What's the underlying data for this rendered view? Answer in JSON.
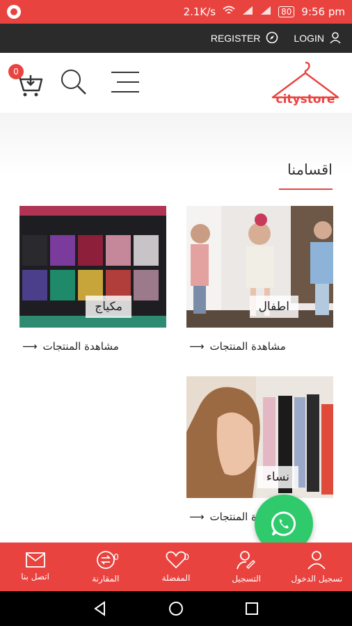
{
  "status": {
    "speed": "2.1K/s",
    "battery": "80",
    "time": "9:56 pm"
  },
  "topbar": {
    "register": "REGISTER",
    "login": "LOGIN"
  },
  "header": {
    "cart_count": "0",
    "logo_text": "citystore"
  },
  "section": {
    "title": "اقسامنا"
  },
  "categories": [
    {
      "name": "اطفال",
      "link": "مشاهدة المنتجات"
    },
    {
      "name": "مكياج",
      "link": "مشاهدة المنتجات"
    },
    {
      "name": "نساء",
      "link": "مشاهدة المنتجات"
    }
  ],
  "bottom_nav": [
    {
      "label": "تسجيل الدخول",
      "icon": "user-icon",
      "count": ""
    },
    {
      "label": "التسجيل",
      "icon": "user-edit-icon",
      "count": ""
    },
    {
      "label": "المفضلة",
      "icon": "heart-icon",
      "count": "0"
    },
    {
      "label": "المقارنة",
      "icon": "compare-icon",
      "count": "0"
    },
    {
      "label": "اتصل بنا",
      "icon": "envelope-icon",
      "count": ""
    }
  ],
  "colors": {
    "accent": "#e9433f",
    "dark": "#2b2b2b",
    "whatsapp": "#2fca6b"
  }
}
